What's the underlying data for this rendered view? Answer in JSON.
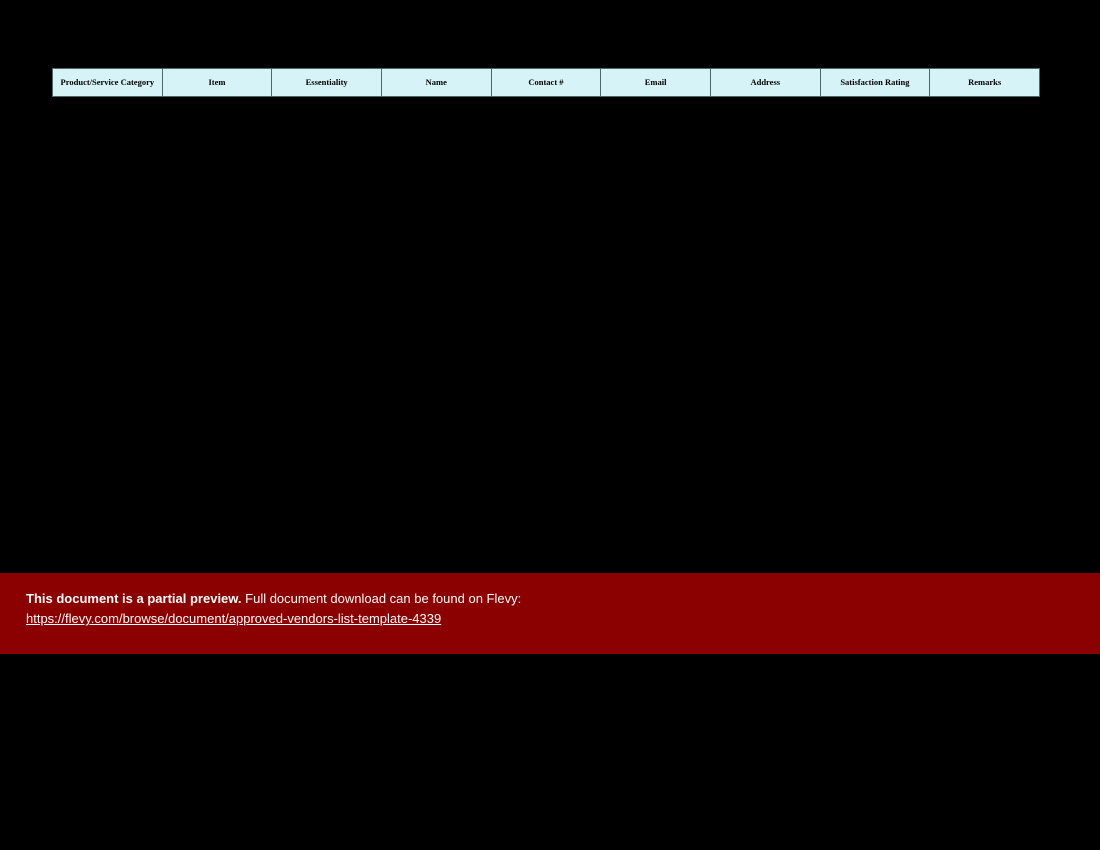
{
  "table": {
    "headers": [
      "Product/Service Category",
      "Item",
      "Essentiality",
      "Name",
      "Contact #",
      "Email",
      "Address",
      "Satisfaction Rating",
      "Remarks"
    ]
  },
  "banner": {
    "bold_text": "This document is a partial preview.",
    "rest_text": "  Full document download can be found on Flevy:",
    "link_text": "https://flevy.com/browse/document/approved-vendors-list-template-4339",
    "link_href": "https://flevy.com/browse/document/approved-vendors-list-template-4339"
  }
}
